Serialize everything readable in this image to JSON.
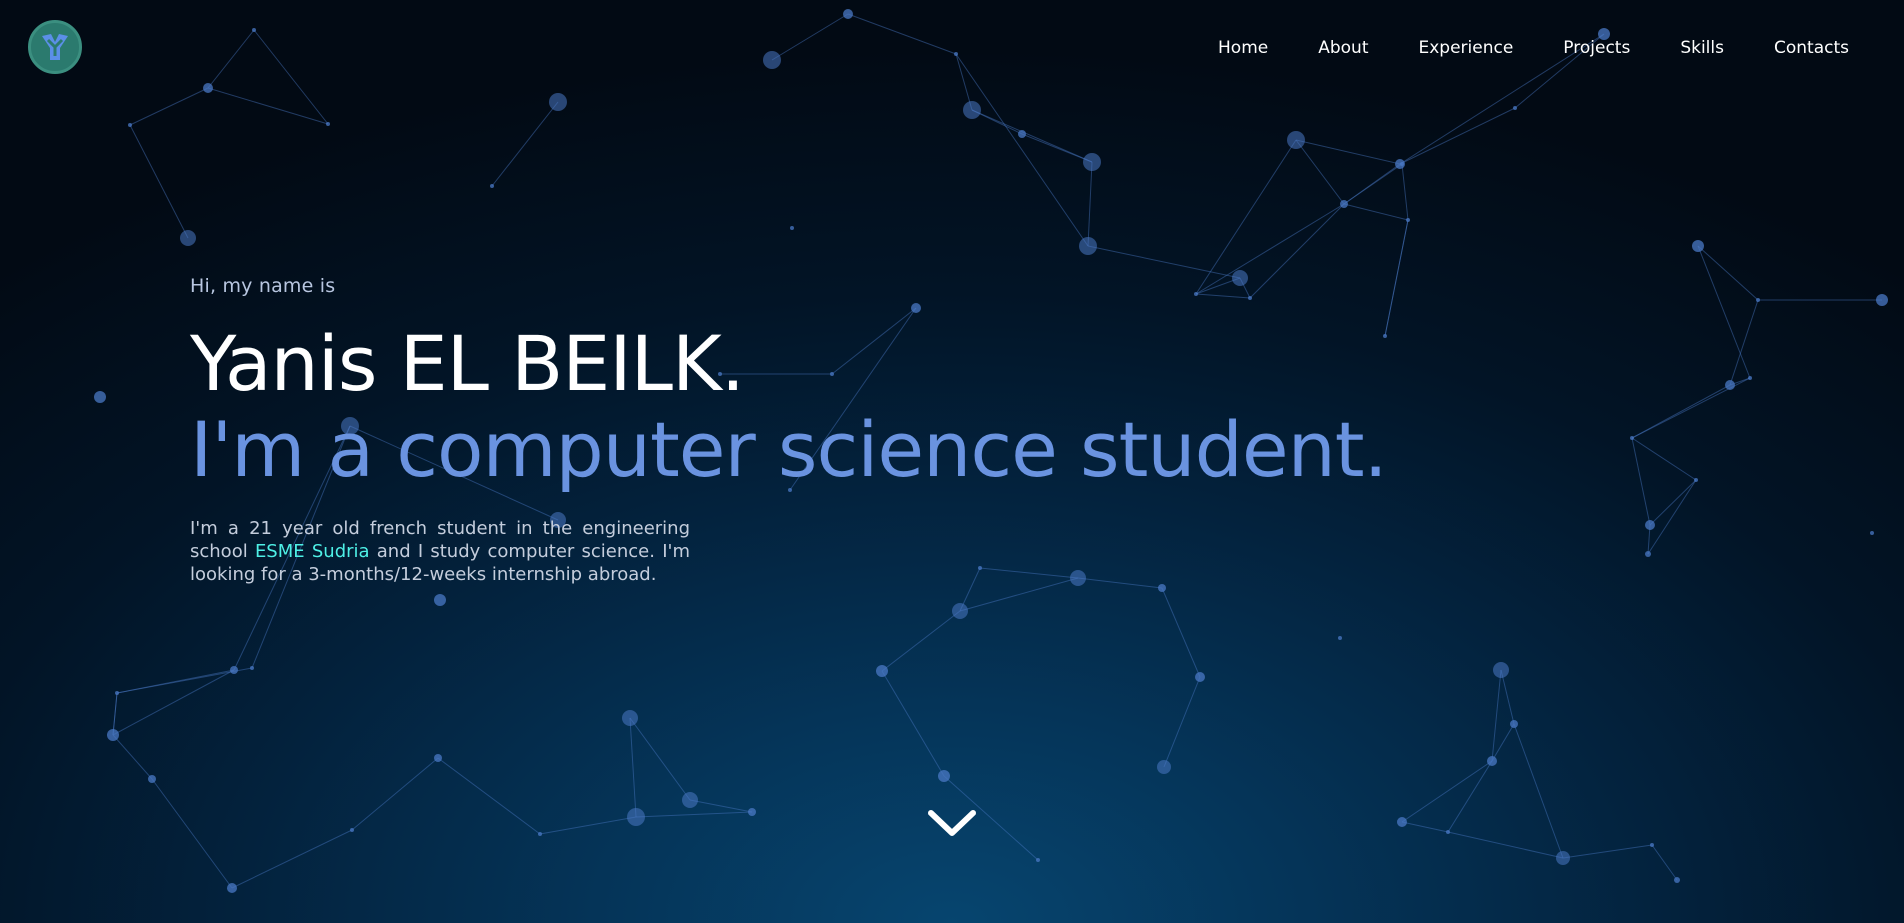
{
  "logo": {
    "icon": "y-logo-icon",
    "bg_color": "#2b7a6e",
    "fg_color": "#5b8fe8"
  },
  "nav": {
    "items": [
      "Home",
      "About",
      "Experience",
      "Projects",
      "Skills",
      "Contacts"
    ]
  },
  "hero": {
    "greeting": "Hi, my name is",
    "name": "Yanis EL BEILK.",
    "tagline": "I'm a computer science student.",
    "bio_before": "I'm a 21 year old french student in the engineering school ",
    "bio_school": "ESME Sudria",
    "bio_after": " and I study computer science. I'm looking for a 3-months/12-weeks internship abroad."
  },
  "scroll_icon": "chevron-down-icon",
  "colors": {
    "accent": "#6a93e0",
    "school_link": "#4ef0e6",
    "particle": "#4a78c4"
  }
}
